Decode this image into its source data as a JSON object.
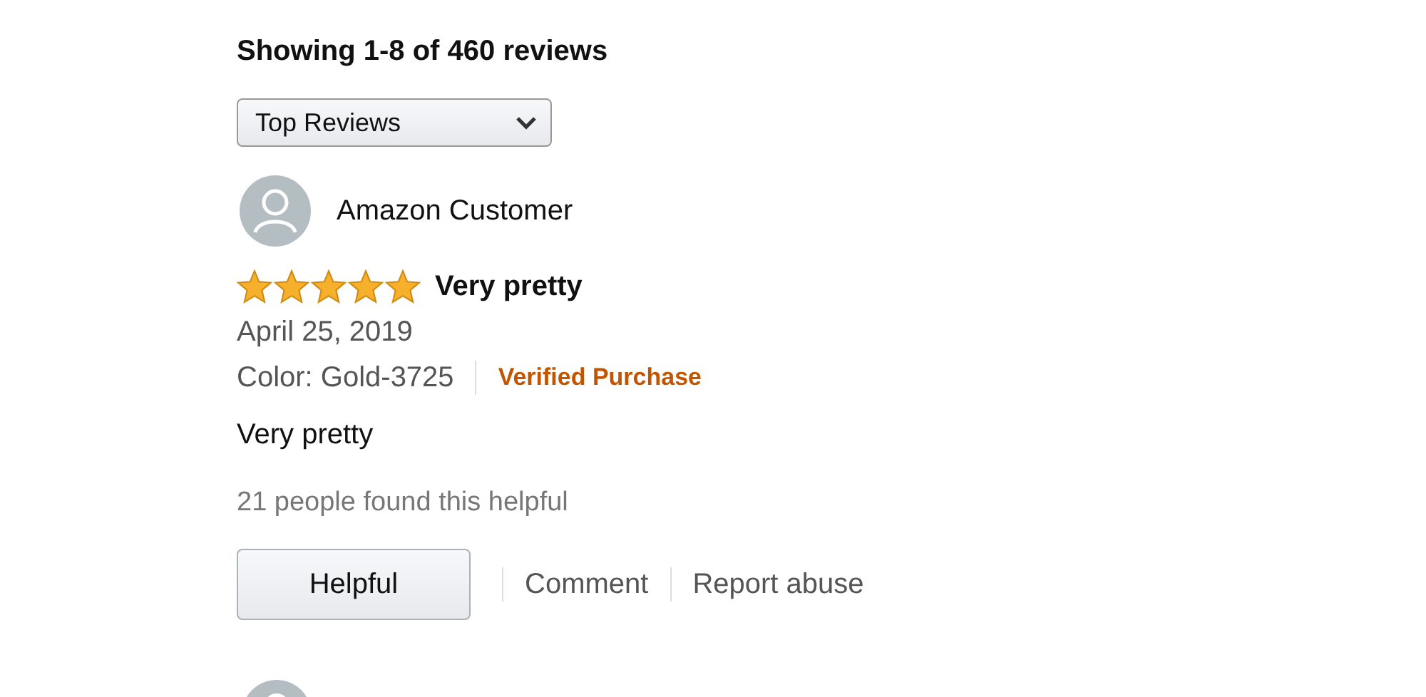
{
  "heading": "Showing 1-8 of 460 reviews",
  "sort": {
    "value": "Top Reviews"
  },
  "reviews": [
    {
      "author": "Amazon Customer",
      "stars": 5,
      "title": "Very pretty",
      "date": "April 25, 2019",
      "variant": "Color: Gold-3725",
      "badge": "Verified Purchase",
      "body": "Very pretty",
      "helpful_count": "21 people found this helpful",
      "actions": [
        "Helpful",
        "Comment",
        "Report abuse"
      ]
    }
  ]
}
